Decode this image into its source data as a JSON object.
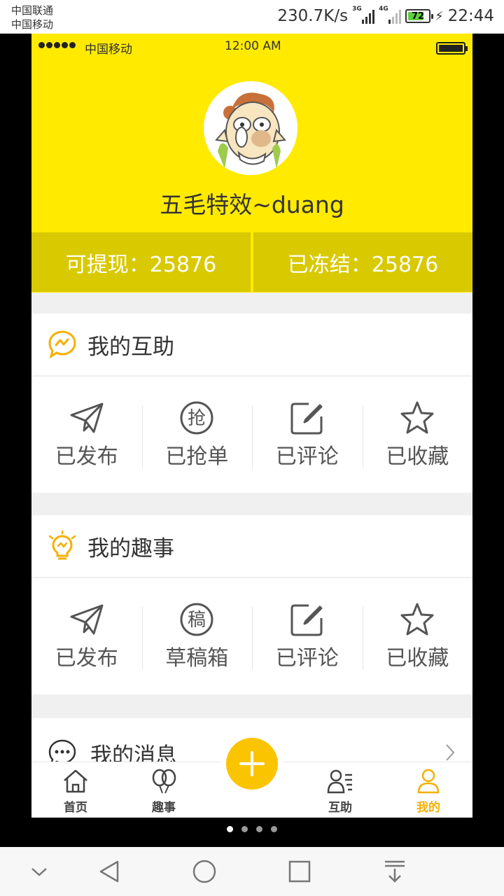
{
  "system_status": {
    "carrier_1": "中国联通",
    "carrier_2": "中国移动",
    "net_speed": "230.7K/s",
    "signal_3g": "3G",
    "signal_4g": "4G",
    "battery_level": "72",
    "time": "22:44"
  },
  "ios_status": {
    "carrier": "中国移动",
    "time": "12:00 AM"
  },
  "profile": {
    "username": "五毛特效~duang"
  },
  "balance": {
    "withdrawable": "可提现：25876",
    "frozen": "已冻结：25876"
  },
  "my_help": {
    "title": "我的互助",
    "items": [
      {
        "label": "已发布",
        "icon": "paper-plane-icon"
      },
      {
        "label": "已抢单",
        "icon": "grab-order-icon",
        "glyph": "抢"
      },
      {
        "label": "已评论",
        "icon": "edit-icon"
      },
      {
        "label": "已收藏",
        "icon": "star-icon"
      }
    ]
  },
  "my_fun": {
    "title": "我的趣事",
    "items": [
      {
        "label": "已发布",
        "icon": "paper-plane-icon"
      },
      {
        "label": "草稿箱",
        "icon": "draft-icon",
        "glyph": "稿"
      },
      {
        "label": "已评论",
        "icon": "edit-icon"
      },
      {
        "label": "已收藏",
        "icon": "star-icon"
      }
    ]
  },
  "messages": {
    "title": "我的消息"
  },
  "tabbar": {
    "tabs": [
      {
        "label": "首页",
        "icon": "home-icon"
      },
      {
        "label": "趣事",
        "icon": "balloons-icon"
      },
      {
        "label": "",
        "icon": "plus-icon"
      },
      {
        "label": "互助",
        "icon": "people-list-icon"
      },
      {
        "label": "我的",
        "icon": "user-icon",
        "active": true
      }
    ]
  },
  "colors": {
    "brand_yellow": "#ffea00",
    "balance_bar": "#d9c900",
    "accent_orange": "#fbc400",
    "active_tab": "#f5b000"
  }
}
